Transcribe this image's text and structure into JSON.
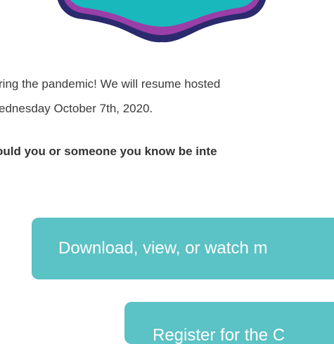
{
  "brand": {
    "wave_colors": {
      "outer": "#2b2a6e",
      "middle": "#9a3ea8",
      "inner": "#19b8bd"
    }
  },
  "content": {
    "line1": "ring the pandemic! We will resume hosted",
    "line2": "ednesday October 7th, 2020.",
    "question": "ould you or someone you know be inte"
  },
  "buttons": {
    "download_label": "Download, view, or watch m",
    "register_label": "Register for the C",
    "color": "#5bc2c5"
  }
}
